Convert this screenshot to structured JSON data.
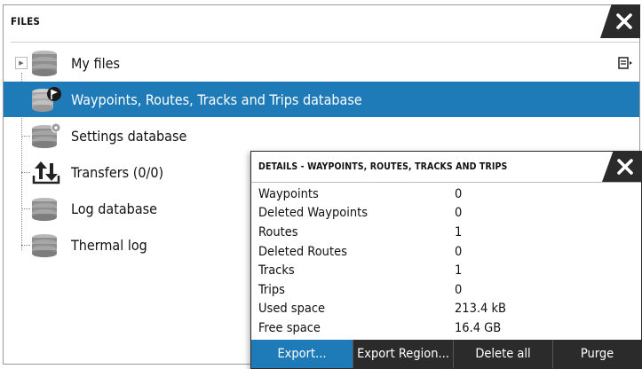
{
  "files_panel": {
    "title": "FILES",
    "items": [
      {
        "label": "My files",
        "icon": "database-icon",
        "expandable": true
      },
      {
        "label": "Waypoints, Routes, Tracks and Trips database",
        "icon": "database-flag-icon",
        "selected": true
      },
      {
        "label": "Settings database",
        "icon": "database-gear-icon"
      },
      {
        "label": "Transfers (0/0)",
        "icon": "transfer-arrows-icon"
      },
      {
        "label": "Log database",
        "icon": "database-icon"
      },
      {
        "label": "Thermal log",
        "icon": "database-icon"
      }
    ]
  },
  "details": {
    "title": "DETAILS - WAYPOINTS, ROUTES, TRACKS AND TRIPS",
    "rows": [
      {
        "key": "Waypoints",
        "value": "0"
      },
      {
        "key": "Deleted Waypoints",
        "value": "0"
      },
      {
        "key": "Routes",
        "value": "1"
      },
      {
        "key": "Deleted Routes",
        "value": "0"
      },
      {
        "key": "Tracks",
        "value": "1"
      },
      {
        "key": "Trips",
        "value": "0"
      },
      {
        "key": "Used space",
        "value": "213.4 kB"
      },
      {
        "key": "Free space",
        "value": "16.4 GB"
      }
    ],
    "buttons": [
      {
        "label": "Export..."
      },
      {
        "label": "Export Region..."
      },
      {
        "label": "Delete all"
      },
      {
        "label": "Purge"
      }
    ]
  },
  "colors": {
    "selection": "#1f7ab8",
    "dark_bar": "#2b2b2b"
  }
}
